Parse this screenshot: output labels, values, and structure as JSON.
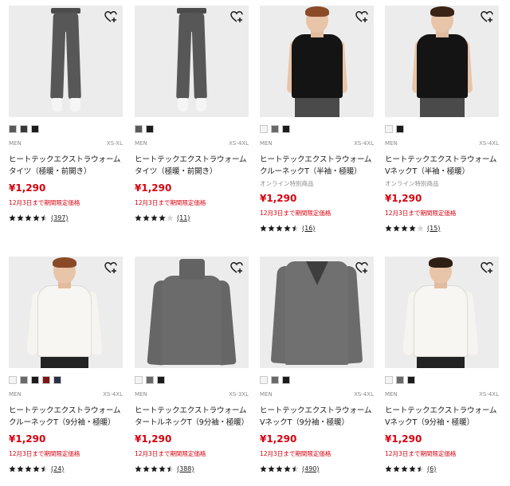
{
  "colors": {
    "price_red": "#d7000f",
    "promo_red": "#d7000f",
    "image_bg": "#ececec",
    "text": "#1b1b1b",
    "muted": "#8a8a8a"
  },
  "products": [
    {
      "category": "MEN",
      "sizes": "XS-XL",
      "title": "ヒートテックエクストラウォームタイツ（極暖・前開き）",
      "note": "",
      "price": "¥1,290",
      "promo": "12月3日まで期間限定価格",
      "rating": 4.5,
      "reviews": "(397)",
      "swatches": [
        "#5a5a5a",
        "#3a3a3a",
        "#1c1c1c"
      ],
      "image": "tights"
    },
    {
      "category": "MEN",
      "sizes": "XS-4XL",
      "title": "ヒートテックエクストラウォームタイツ（極暖・前開き）",
      "note": "",
      "price": "¥1,290",
      "promo": "12月3日まで期間限定価格",
      "rating": 4,
      "reviews": "(11)",
      "swatches": [
        "#5a5a5a",
        "#1c1c1c"
      ],
      "image": "tights"
    },
    {
      "category": "MEN",
      "sizes": "XS-4XL",
      "title": "ヒートテックエクストラウォームクルーネックT（半袖・極暖）",
      "note": "オンライン特別商品",
      "price": "¥1,290",
      "promo": "12月3日まで期間限定価格",
      "rating": 4.5,
      "reviews": "(16)",
      "swatches": [
        "#f4f4f4",
        "#6a6a6a",
        "#1c1c1c"
      ],
      "image": "model-black-tee"
    },
    {
      "category": "MEN",
      "sizes": "XS-4XL",
      "title": "ヒートテックエクストラウォームVネックT（半袖・極暖）",
      "note": "オンライン特別商品",
      "price": "¥1,290",
      "promo": "12月3日まで期間限定価格",
      "rating": 4,
      "reviews": "(15)",
      "swatches": [
        "#f4f4f4",
        "#1c1c1c"
      ],
      "image": "model-black-vtee"
    },
    {
      "category": "MEN",
      "sizes": "XS-4XL",
      "title": "ヒートテックエクストラウォームクルーネックT（9分袖・極暖）",
      "note": "",
      "price": "¥1,290",
      "promo": "12月3日まで期間限定価格",
      "rating": 4.5,
      "reviews": "(24)",
      "swatches": [
        "#f4f4f4",
        "#6a6a6a",
        "#1c1c1c",
        "#7a1616",
        "#2a3045"
      ],
      "image": "model-white-long"
    },
    {
      "category": "MEN",
      "sizes": "XS-3XL",
      "title": "ヒートテックエクストラウォームタートルネックT（9分袖・極暖）",
      "note": "",
      "price": "¥1,290",
      "promo": "12月3日まで期間限定価格",
      "rating": 4.5,
      "reviews": "(388)",
      "swatches": [
        "#f4f4f4",
        "#6a6a6a",
        "#1c1c1c"
      ],
      "image": "turtleneck"
    },
    {
      "category": "MEN",
      "sizes": "XS-4XL",
      "title": "ヒートテックエクストラウォームVネックT（9分袖・極暖）",
      "note": "",
      "price": "¥1,290",
      "promo": "12月3日まで期間限定価格",
      "rating": 4.5,
      "reviews": "(490)",
      "swatches": [
        "#f4f4f4",
        "#6a6a6a",
        "#1c1c1c"
      ],
      "image": "vneck-long"
    },
    {
      "category": "MEN",
      "sizes": "XS-4XL",
      "title": "ヒートテックエクストラウォームVネックT（9分袖・極暖）",
      "note": "",
      "price": "¥1,290",
      "promo": "12月3日まで期間限定価格",
      "rating": 4.5,
      "reviews": "(6)",
      "swatches": [
        "#f4f4f4",
        "#6a6a6a",
        "#1c1c1c"
      ],
      "image": "model-white-vlong"
    }
  ],
  "icons": {
    "favorite": "heart-plus-icon",
    "star": "star-icon"
  }
}
